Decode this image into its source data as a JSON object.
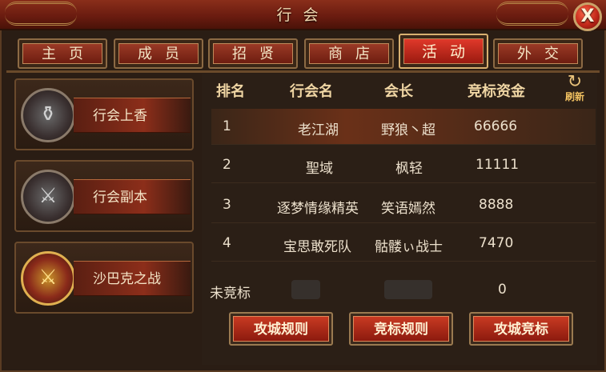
{
  "window": {
    "title": "行会",
    "close_icon": "close-icon"
  },
  "tabs": [
    {
      "label": "主页",
      "active": false
    },
    {
      "label": "成员",
      "active": false
    },
    {
      "label": "招贤",
      "active": false
    },
    {
      "label": "商店",
      "active": false
    },
    {
      "label": "活动",
      "active": true
    },
    {
      "label": "外交",
      "active": false
    }
  ],
  "sidebar": {
    "items": [
      {
        "label": "行会上香",
        "icon": "incense-urn-icon"
      },
      {
        "label": "行会副本",
        "icon": "crossed-swords-icon"
      },
      {
        "label": "沙巴克之战",
        "icon": "castle-war-emblem-icon"
      }
    ]
  },
  "table": {
    "headers": [
      "排名",
      "行会名",
      "会长",
      "竞标资金"
    ],
    "refresh_label": "刷新",
    "rows": [
      {
        "rank": "1",
        "guild": "老江湖",
        "leader": "野狼丶超",
        "funds": "66666",
        "highlight": true
      },
      {
        "rank": "2",
        "guild": "聖域",
        "leader": "枫轻",
        "funds": "11111",
        "highlight": false
      },
      {
        "rank": "3",
        "guild": "逐梦情缘精英",
        "leader": "笑语嫣然",
        "funds": "8888",
        "highlight": false
      },
      {
        "rank": "4",
        "guild": "宝思敢死队",
        "leader": "骷髅ぃ战士",
        "funds": "7470",
        "highlight": false
      }
    ],
    "unbid": {
      "label": "未竞标",
      "value": "0"
    }
  },
  "buttons": {
    "siege_rules": "攻城规则",
    "bid_rules": "竞标规则",
    "siege_bid": "攻城竞标"
  }
}
